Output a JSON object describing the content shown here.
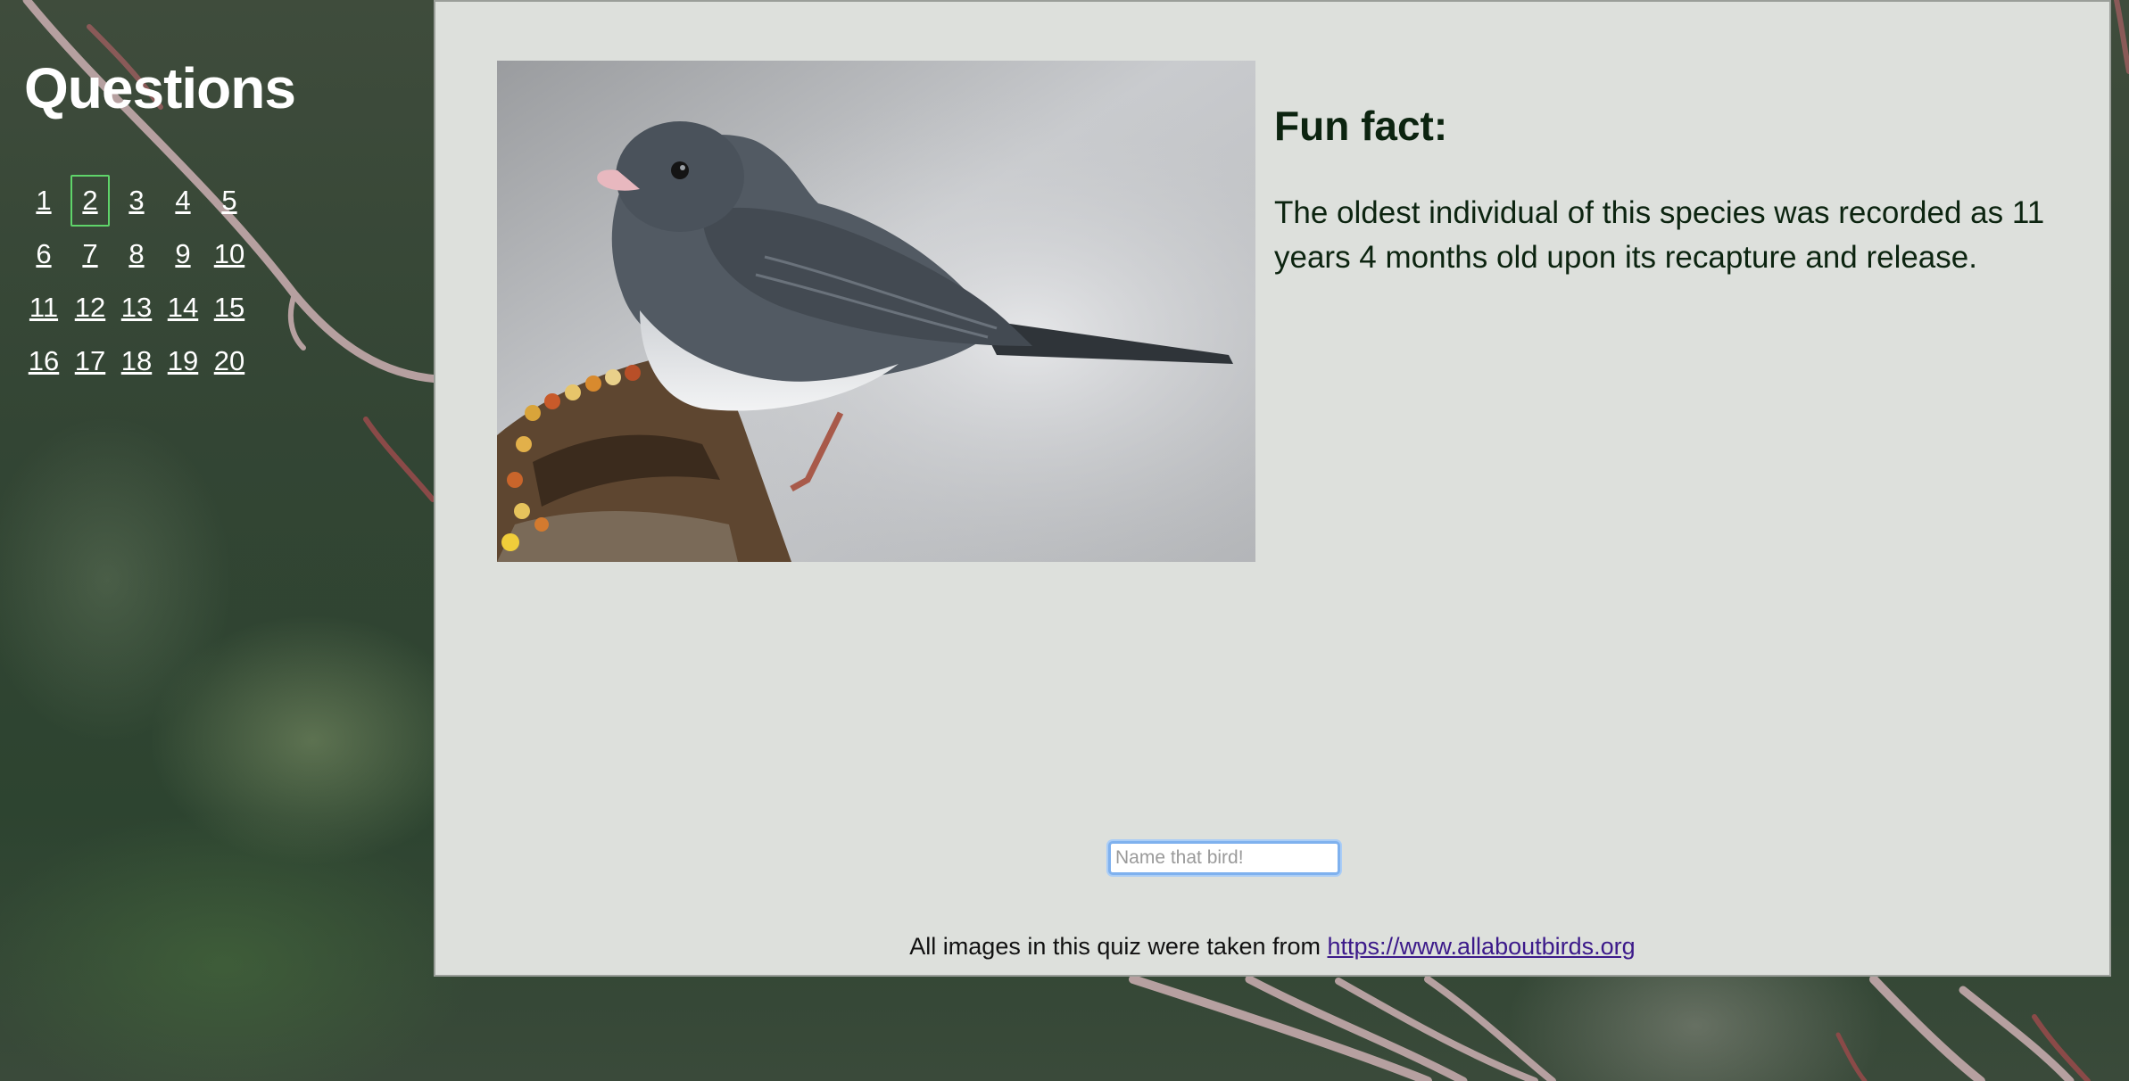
{
  "sidebar": {
    "title": "Questions",
    "questions": [
      "1",
      "2",
      "3",
      "4",
      "5",
      "6",
      "7",
      "8",
      "9",
      "10",
      "11",
      "12",
      "13",
      "14",
      "15",
      "16",
      "17",
      "18",
      "19",
      "20"
    ],
    "active_question": "2"
  },
  "main": {
    "fun_fact": {
      "heading": "Fun fact:",
      "text": "The oldest individual of this species was recorded as 11 years 4 months old upon its recapture and release."
    },
    "answer_input": {
      "placeholder": "Name that bird!",
      "value": ""
    },
    "footer": {
      "text": "All images in this quiz were taken from ",
      "link_text": "https://www.allaboutbirds.org"
    }
  },
  "colors": {
    "panel_bg": "#dde0dc",
    "heading_text": "#0c2410",
    "active_border": "#5fd46a",
    "link_visited": "#3c1a8a"
  }
}
